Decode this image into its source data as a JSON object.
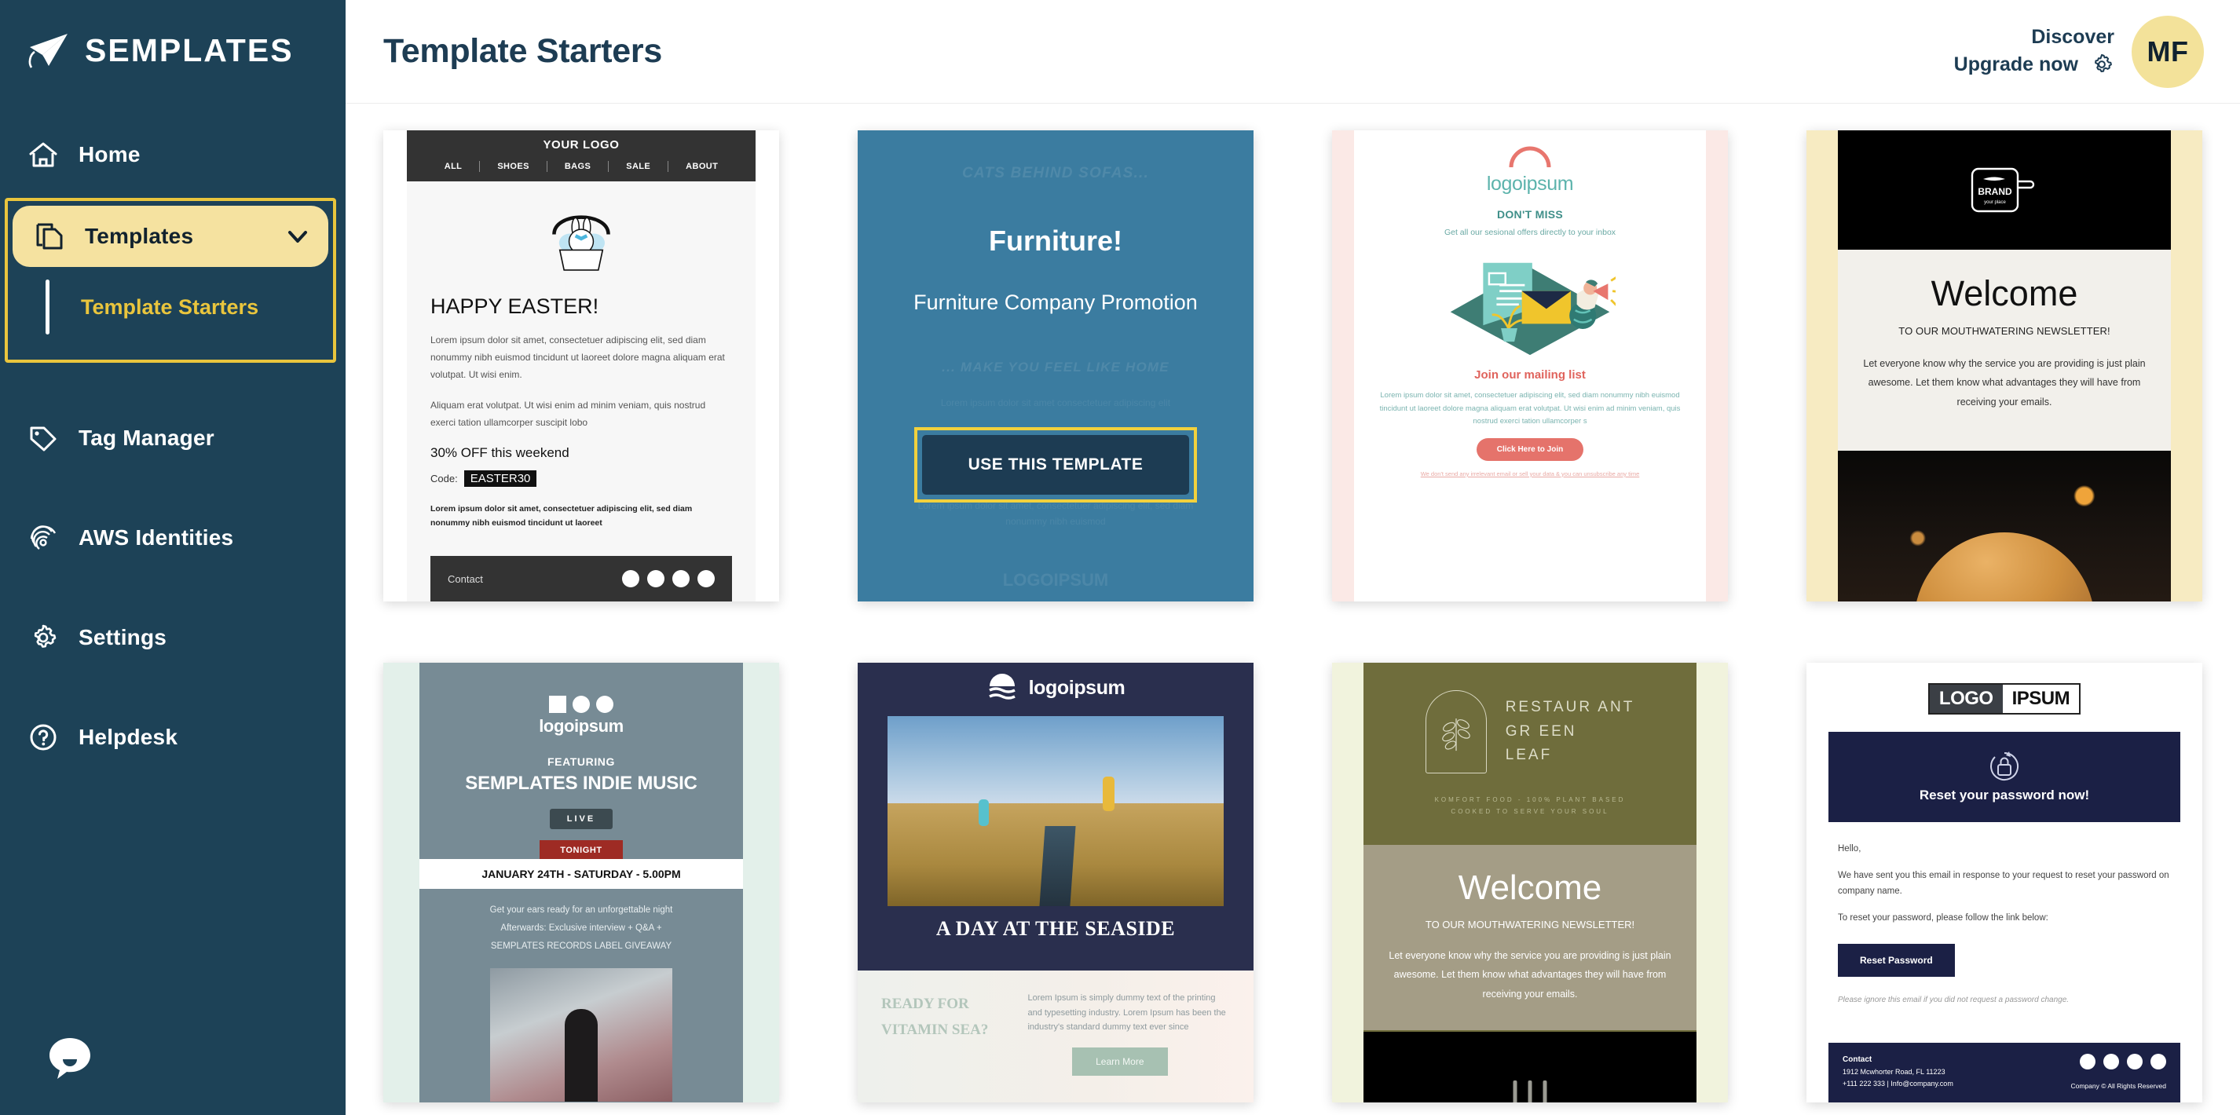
{
  "brand": {
    "name": "SEMPLATES",
    "icon": "paper-plane-icon"
  },
  "sidebar": {
    "items": [
      {
        "label": "Home",
        "icon": "home-icon"
      },
      {
        "label": "Tag Manager",
        "icon": "tag-icon"
      },
      {
        "label": "AWS Identities",
        "icon": "fingerprint-icon"
      },
      {
        "label": "Settings",
        "icon": "gear-icon"
      },
      {
        "label": "Helpdesk",
        "icon": "question-circle-icon"
      }
    ],
    "templates_group": {
      "label": "Templates",
      "icon": "copy-documents-icon",
      "chevron": "chevron-down-icon",
      "sub_item": "Template Starters"
    },
    "chat_icon": "chat-bubble-icon"
  },
  "header": {
    "title": "Template Starters",
    "discover": "Discover",
    "upgrade": "Upgrade now",
    "gear_icon": "gear-icon",
    "avatar_initials": "MF"
  },
  "colors": {
    "sidebar_bg": "#1d4257",
    "accent_yellow": "#e9c53d",
    "pill_yellow": "#f5e2a0",
    "avatar_yellow": "#f3e29a",
    "text_dark": "#1d3c53"
  },
  "cards": [
    {
      "id": "easter",
      "logo": "YOUR LOGO",
      "menu": [
        "ALL",
        "SHOES",
        "BAGS",
        "SALE",
        "ABOUT"
      ],
      "heading": "HAPPY EASTER!",
      "paragraph1": "Lorem ipsum dolor sit amet, consectetuer adipiscing elit, sed diam nonummy nibh euismod tincidunt ut laoreet dolore magna aliquam erat volutpat. Ut wisi enim.",
      "paragraph2": "Aliquam erat volutpat. Ut wisi enim ad minim veniam, quis nostrud exerci tation ullamcorper suscipit lobo",
      "offer": "30% OFF this weekend",
      "code_label": "Code:",
      "code_value": "EASTER30",
      "fine_print": "Lorem ipsum dolor sit amet, consectetuer adipiscing elit, sed diam nonummy nibh euismod tincidunt ut laoreet",
      "footer": "Contact"
    },
    {
      "id": "furniture",
      "ghost_top": "CATS BEHIND SOFAS...",
      "heading": "Furniture!",
      "subheading": "Furniture Company Promotion",
      "ghost_mid": "... MAKE YOU FEEL LIKE HOME",
      "ghost_line": "Lorem ipsum dolor sit amet consectetuer adipiscing elit",
      "ghost_body": "Lorem ipsum dolor sit amet, consectetuer adipiscing elit, sed diam nonummy nibh euismod",
      "ghost_logo": "LOGOIPSUM",
      "cta": "USE THIS TEMPLATE"
    },
    {
      "id": "mailing-list",
      "logo": "logoipsum",
      "kicker": "DON'T MISS",
      "subtitle": "Get all our sesional offers directly to your inbox",
      "heading": "Join our mailing list",
      "paragraph": "Lorem ipsum dolor sit amet, consectetuer adipiscing elit, sed diam nonummy nibh euismod tincidunt ut laoreet dolore magna aliquam erat volutpat. Ut wisi enim ad minim veniam, quis nostrud exerci tation ullamcorper s",
      "cta": "Click Here to Join",
      "fine_print": "We don't send any irrelevant email or sell your data & you can unsubscribe any time"
    },
    {
      "id": "welcome-food",
      "brand_name": "BRAND",
      "brand_tag": "your place",
      "heading": "Welcome",
      "subheading": "TO OUR MOUTHWATERING NEWSLETTER!",
      "paragraph": "Let everyone know why the service you are providing is just plain awesome. Let them know what advantages they will have from receiving your emails."
    },
    {
      "id": "indie-music",
      "logo": "logoipsum",
      "featuring": "FEATURING",
      "title": "SEMPLATES INDIE MUSIC",
      "live_badge": "LIVE",
      "tonight_badge": "TONIGHT",
      "date": "JANUARY 24TH - SATURDAY - 5.00PM",
      "line1": "Get your ears ready for an unforgettable night",
      "line2": "Afterwards: Exclusive interview + Q&A +",
      "line3": "SEMPLATES RECORDS LABEL GIVEAWAY"
    },
    {
      "id": "seaside",
      "logo": "logoipsum",
      "title": "A DAY AT THE SEASIDE",
      "left_heading": "READY FOR VITAMIN SEA?",
      "paragraph": "Lorem Ipsum is simply dummy text of the printing and typesetting industry. Lorem Ipsum has been the industry's standard dummy text ever since",
      "cta": "Learn More"
    },
    {
      "id": "restaurant-green-leaf",
      "name_line1": "RESTAUR ANT",
      "name_line2": "GR EEN",
      "name_line3": "LEAF",
      "tagline_line1": "KOMFORT FOOD - 100% PLANT BASED",
      "tagline_line2": "COOKED TO SERVE YOUR SOUL",
      "heading": "Welcome",
      "subheading": "TO OUR MOUTHWATERING NEWSLETTER!",
      "paragraph": "Let everyone know why the service you are providing is just plain awesome. Let them know what advantages they will have from receiving your emails."
    },
    {
      "id": "reset-password",
      "logo_a": "LOGO",
      "logo_b": "IPSUM",
      "band_text": "Reset your password now!",
      "greeting": "Hello,",
      "paragraph1": "We have sent you this email in response to your request to reset your password on company name.",
      "paragraph2": "To reset your password, please follow the link below:",
      "cta": "Reset Password",
      "note": "Please ignore this email if you did not request a password change.",
      "footer_title": "Contact",
      "footer_address": "1912 Mcwhorter Road, FL 11223",
      "footer_contact": "+111 222 333 | Info@company.com",
      "footer_copy": "Company © All Rights Reserved"
    }
  ]
}
